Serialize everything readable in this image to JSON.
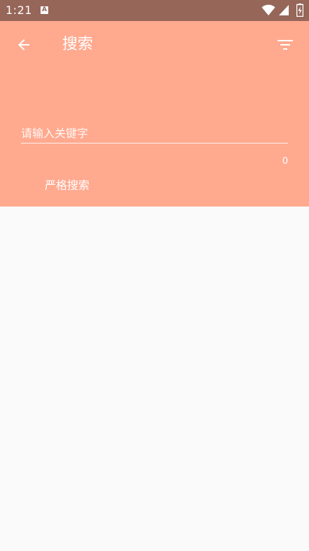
{
  "status_bar": {
    "time": "1:21",
    "notification_icon_letter": "A",
    "icons": [
      "wifi-icon",
      "cell-signal-icon",
      "battery-charging-icon"
    ],
    "background": "#966659"
  },
  "app_bar": {
    "title": "搜索",
    "background": "#FFA98F",
    "back_icon": "arrow-left-icon",
    "filter_icon": "filter-icon"
  },
  "search": {
    "placeholder": "请输入关键字",
    "value": "",
    "counter": "0"
  },
  "options": {
    "strict_search_label": "严格搜索"
  }
}
